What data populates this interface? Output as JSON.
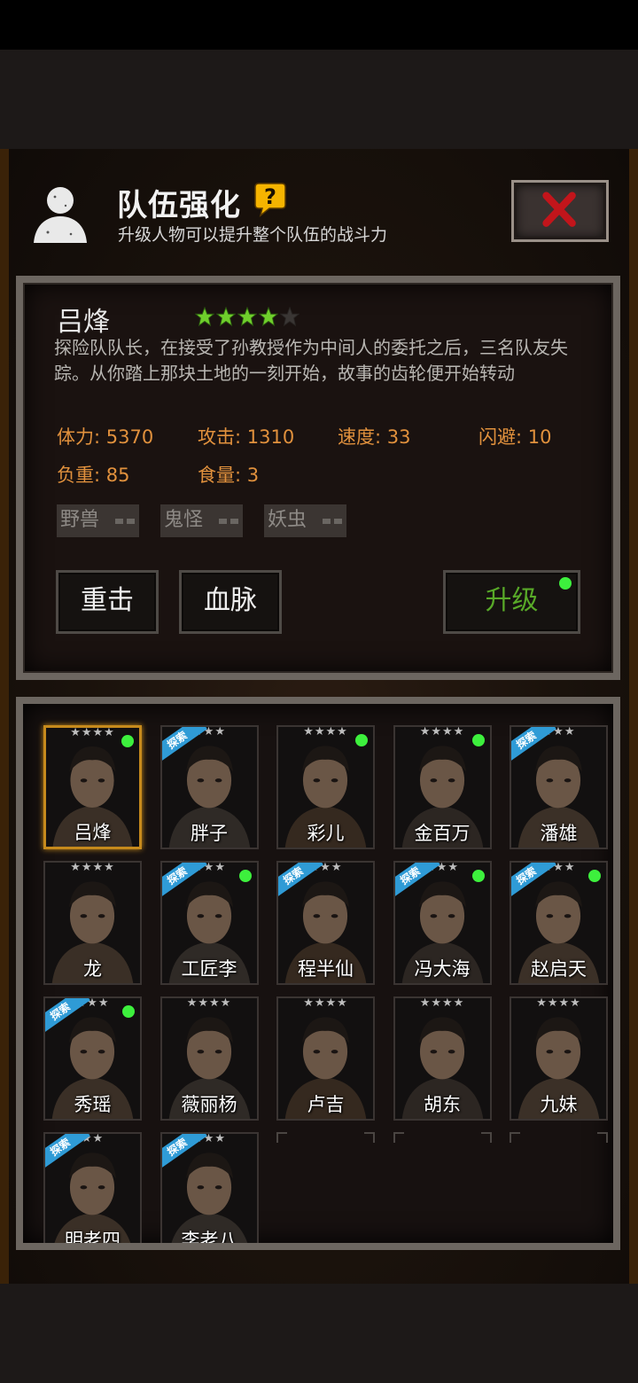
{
  "header": {
    "title": "队伍强化",
    "subtitle": "升级人物可以提升整个队伍的战斗力",
    "help_icon": "question-icon",
    "close_icon": "close-x-icon"
  },
  "character": {
    "name": "吕烽",
    "stars_filled": 4,
    "stars_total": 5,
    "description": "探险队队长，在接受了孙教授作为中间人的委托之后，三名队友失踪。从你踏上那块土地的一刻开始，故事的齿轮便开始转动",
    "stats": {
      "stamina": "体力: 5370",
      "attack": "攻击: 1310",
      "speed": "速度: 33",
      "dodge": "闪避: 10",
      "load": "负重: 85",
      "food": "食量: 3"
    },
    "tags": [
      "野兽",
      "鬼怪",
      "妖虫"
    ],
    "buttons": {
      "heavy_strike": "重击",
      "bloodline": "血脉",
      "upgrade": "升级"
    }
  },
  "roster": [
    {
      "name": "吕烽",
      "stars": "★★★★",
      "explore": false,
      "dot": true,
      "selected": true
    },
    {
      "name": "胖子",
      "stars": "★★★",
      "explore": true,
      "dot": false
    },
    {
      "name": "彩儿",
      "stars": "★★★★",
      "explore": false,
      "dot": true
    },
    {
      "name": "金百万",
      "stars": "★★★★",
      "explore": false,
      "dot": true
    },
    {
      "name": "潘雄",
      "stars": "★★★",
      "explore": true,
      "dot": false
    },
    {
      "name": "龙",
      "stars": "★★★★",
      "explore": false,
      "dot": false
    },
    {
      "name": "工匠李",
      "stars": "★★★",
      "explore": true,
      "dot": true
    },
    {
      "name": "程半仙",
      "stars": "★★★",
      "explore": true,
      "dot": false
    },
    {
      "name": "冯大海",
      "stars": "★★★",
      "explore": true,
      "dot": true
    },
    {
      "name": "赵启天",
      "stars": "★★★",
      "explore": true,
      "dot": true
    },
    {
      "name": "秀瑶",
      "stars": "★★★",
      "explore": true,
      "dot": true
    },
    {
      "name": "薇丽杨",
      "stars": "★★★★",
      "explore": false,
      "dot": false
    },
    {
      "name": "卢吉",
      "stars": "★★★★",
      "explore": false,
      "dot": false
    },
    {
      "name": "胡东",
      "stars": "★★★★",
      "explore": false,
      "dot": false
    },
    {
      "name": "九妹",
      "stars": "★★★★",
      "explore": false,
      "dot": false
    },
    {
      "name": "明老四",
      "stars": "★★",
      "explore": true,
      "dot": false
    },
    {
      "name": "李老八",
      "stars": "★★★",
      "explore": true,
      "dot": false
    }
  ],
  "explore_label": "探索",
  "colors": {
    "stat_text": "#e1913d",
    "upgrade_text": "#58a928",
    "star_filled": "#6fcf2c",
    "new_dot": "#3df03d",
    "explore_ribbon": "#2f9bd6",
    "selected_border": "#c68a1c"
  }
}
